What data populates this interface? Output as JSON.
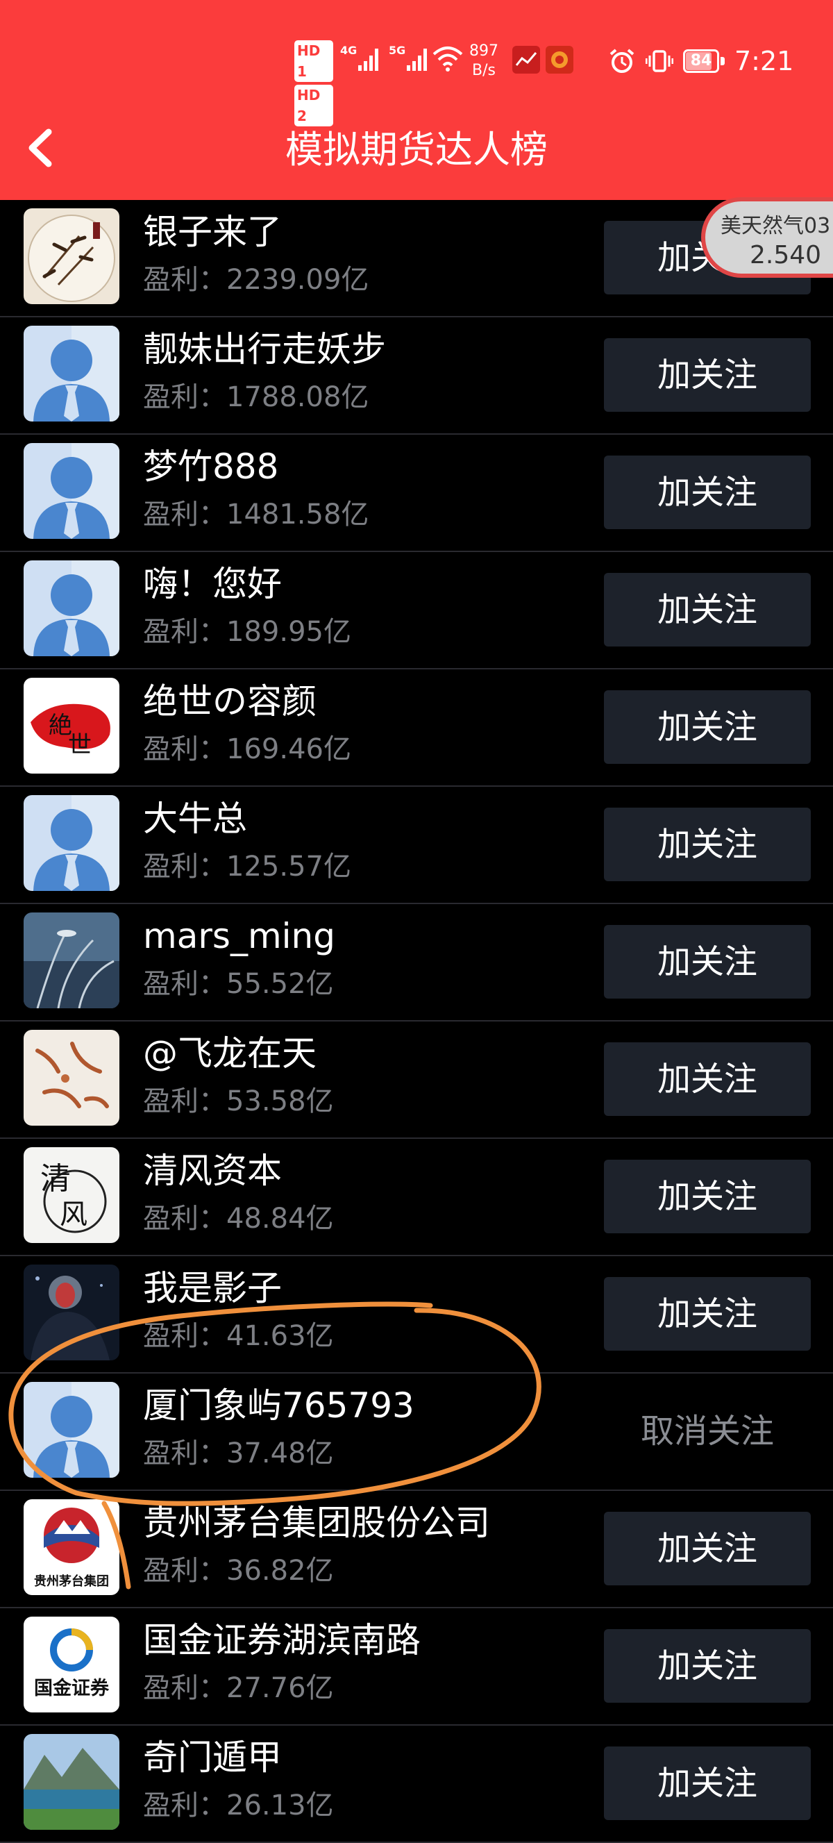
{
  "status_bar": {
    "hd1": "HD 1",
    "hd2": "HD 2",
    "net1": "4G",
    "net2": "5G",
    "speed_value": "897",
    "speed_unit": "B/s",
    "battery": "84",
    "time": "7:21"
  },
  "header": {
    "title": "模拟期货达人榜"
  },
  "profit_label": "盈利：",
  "floating_ticker": {
    "name": "美天然气03",
    "price": "2.540"
  },
  "follow_label": "加关注",
  "unfollow_label": "取消关注",
  "rows": [
    {
      "name": "银子来了",
      "profit": "2239.09亿",
      "avatar_icon": "ink-bamboo-painting",
      "button": "加关注"
    },
    {
      "name": "靓妹出行走妖步",
      "profit": "1788.08亿",
      "avatar_icon": "default-person",
      "button": "加关注"
    },
    {
      "name": "梦竹888",
      "profit": "1481.58亿",
      "avatar_icon": "default-person",
      "button": "加关注"
    },
    {
      "name": "嗨！您好",
      "profit": "189.95亿",
      "avatar_icon": "default-person",
      "button": "加关注"
    },
    {
      "name": "绝世の容颜",
      "profit": "169.46亿",
      "avatar_icon": "red-brush-calligraphy",
      "button": "加关注"
    },
    {
      "name": "大牛总",
      "profit": "125.57亿",
      "avatar_icon": "default-person",
      "button": "加关注"
    },
    {
      "name": "mars_ming",
      "profit": "55.52亿",
      "avatar_icon": "reed-sky-photo",
      "button": "加关注"
    },
    {
      "name": "@飞龙在天",
      "profit": "53.58亿",
      "avatar_icon": "marble-stone",
      "button": "加关注"
    },
    {
      "name": "清风资本",
      "profit": "48.84亿",
      "avatar_icon": "calligraphy-qingfeng",
      "button": "加关注"
    },
    {
      "name": "我是影子",
      "profit": "41.63亿",
      "avatar_icon": "masked-figure",
      "button": "加关注"
    },
    {
      "name": "厦门象屿765793",
      "profit": "37.48亿",
      "avatar_icon": "default-person",
      "button": "取消关注"
    },
    {
      "name": "贵州茅台集团股份公司",
      "profit": "36.82亿",
      "avatar_icon": "moutai-logo",
      "button": "加关注",
      "avatar_text": "贵州茅台集团"
    },
    {
      "name": "国金证券湖滨南路",
      "profit": "27.76亿",
      "avatar_icon": "guojin-securities-logo",
      "button": "加关注",
      "avatar_text": "国金证券"
    },
    {
      "name": "奇门遁甲",
      "profit": "26.13亿",
      "avatar_icon": "mountain-lake-photo",
      "button": "加关注"
    }
  ],
  "colors": {
    "header_red": "#fb3c3c",
    "button_bg": "#1d222b",
    "annotation_orange": "#f0903c"
  }
}
